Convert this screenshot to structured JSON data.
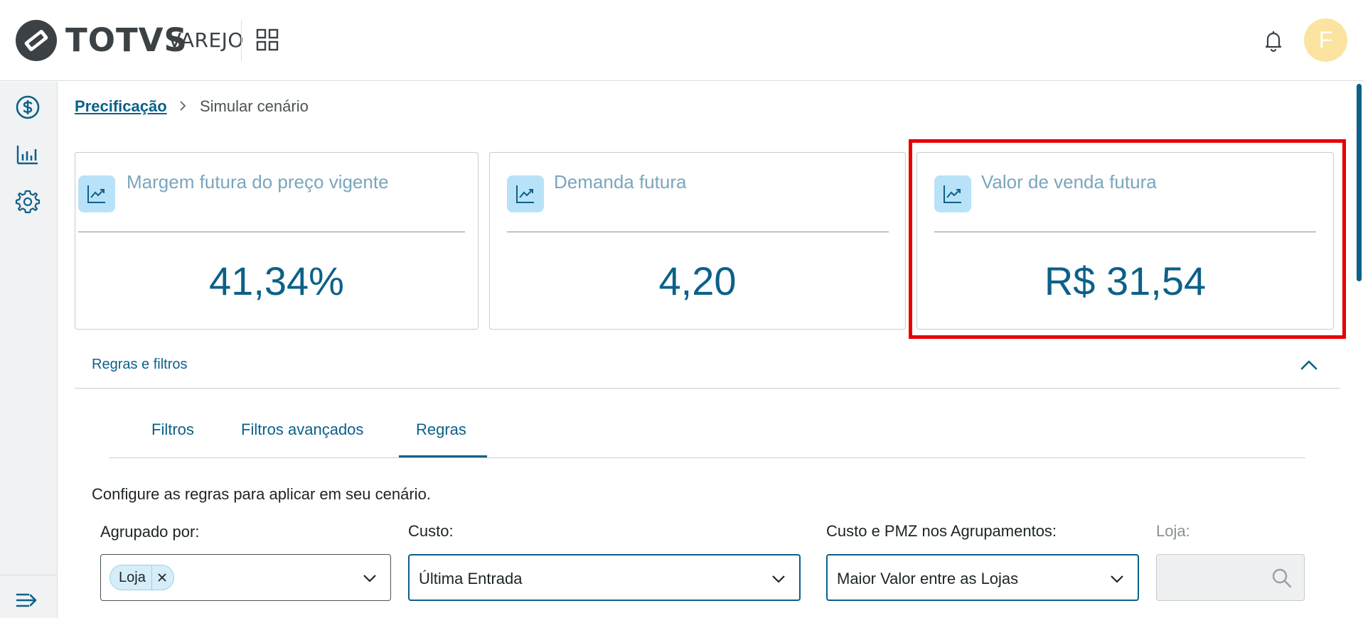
{
  "header": {
    "brand": "TOTVS",
    "brand_sub": "VAREJO",
    "avatar_initial": "F",
    "icons": {
      "logo": "totvs-logo-icon",
      "apps": "apps-grid-icon",
      "notifications": "bell-icon"
    }
  },
  "sidebar": {
    "items": [
      {
        "icon": "dollar-circle-icon"
      },
      {
        "icon": "bar-chart-icon"
      },
      {
        "icon": "gear-icon"
      }
    ],
    "collapse_icon": "expand-menu-icon"
  },
  "breadcrumb": {
    "link": "Precificação",
    "current": "Simular cenário"
  },
  "cards": [
    {
      "title": "Margem futura do preço vigente",
      "value": "41,34%",
      "icon": "trending-chart-icon"
    },
    {
      "title": "Demanda futura",
      "value": "4,20",
      "icon": "trending-chart-icon"
    },
    {
      "title": "Valor de venda futura",
      "value": "R$ 31,54",
      "icon": "trending-chart-icon"
    }
  ],
  "section": {
    "title": "Regras e filtros"
  },
  "tabs": [
    {
      "label": "Filtros",
      "active": false
    },
    {
      "label": "Filtros avançados",
      "active": false
    },
    {
      "label": "Regras",
      "active": true
    }
  ],
  "rules": {
    "description": "Configure as regras para aplicar em seu cenário.",
    "grouped_by": {
      "label": "Agrupado por:",
      "tag": "Loja"
    },
    "cost": {
      "label": "Custo:",
      "value": "Última Entrada"
    },
    "cost_pmz": {
      "label": "Custo e PMZ nos Agrupamentos:",
      "value": "Maior Valor entre as Lojas"
    },
    "store": {
      "label": "Loja:",
      "value": ""
    }
  },
  "colors": {
    "primary": "#0c6089",
    "card_title": "#7aa6bd",
    "card_icon_bg": "#b8e2f7",
    "highlight": "#e60000",
    "avatar_bg": "#fbe4a0"
  }
}
